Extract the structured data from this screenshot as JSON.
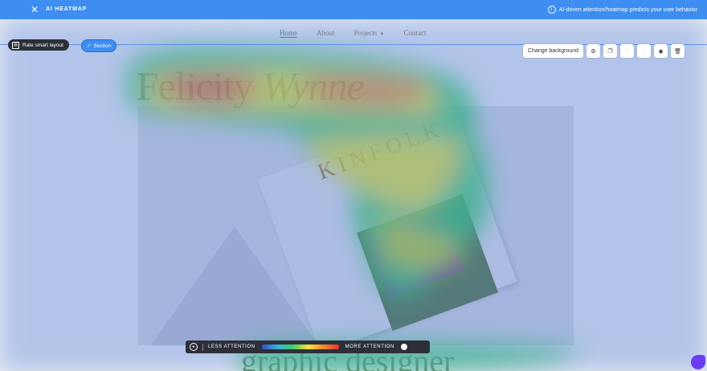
{
  "topbar": {
    "title": "AI HEATMAP",
    "info_text": "AI-driven attention/heatmap predicts your user behavior",
    "close_icon": "close-icon",
    "info_icon": "info-circle-icon"
  },
  "nav": {
    "items": [
      "Home",
      "About",
      "Projects",
      "Contact"
    ],
    "active": "Home"
  },
  "editor": {
    "rate_label": "Rate smart layout",
    "section_label": "Section",
    "change_background": "Change background"
  },
  "site": {
    "name_first": "Felicity",
    "name_last": "Wynne",
    "magazine": "KINFOLK",
    "subtitle": "graphic designer"
  },
  "legend": {
    "less": "LESS ATTENTION",
    "more": "MORE ATTENTION"
  },
  "colors": {
    "accent": "#3d8ef0",
    "dark": "#2c2f38"
  }
}
